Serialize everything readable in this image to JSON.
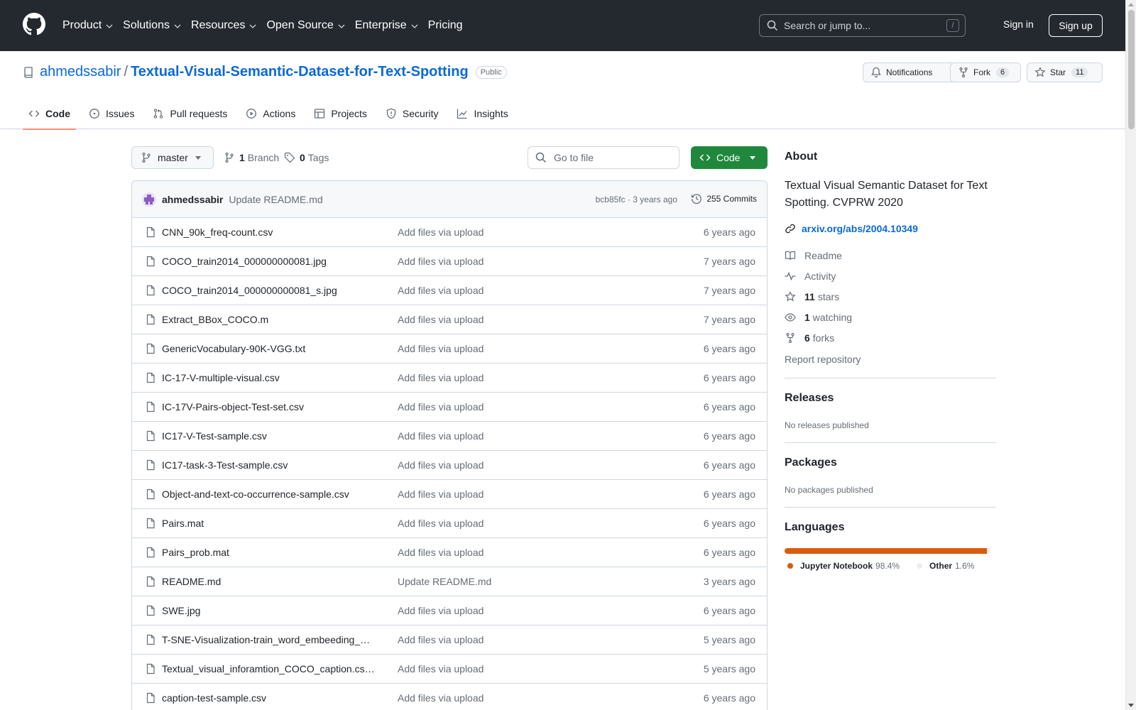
{
  "header": {
    "nav": [
      {
        "label": "Product",
        "dropdown": true
      },
      {
        "label": "Solutions",
        "dropdown": true
      },
      {
        "label": "Resources",
        "dropdown": true
      },
      {
        "label": "Open Source",
        "dropdown": true
      },
      {
        "label": "Enterprise",
        "dropdown": true
      },
      {
        "label": "Pricing",
        "dropdown": false
      }
    ],
    "search_placeholder": "Search or jump to...",
    "search_shortcut": "/",
    "signin_label": "Sign in",
    "signup_label": "Sign up"
  },
  "repo": {
    "owner": "ahmedssabir",
    "separator": "/",
    "name": "Textual-Visual-Semantic-Dataset-for-Text-Spotting",
    "visibility": "Public",
    "notifications_label": "Notifications",
    "fork_label": "Fork",
    "fork_count": "6",
    "star_label": "Star",
    "star_count": "11"
  },
  "tabs": [
    {
      "label": "Code",
      "icon": "code-icon",
      "active": true
    },
    {
      "label": "Issues",
      "icon": "issue-icon",
      "active": false
    },
    {
      "label": "Pull requests",
      "icon": "pull-request-icon",
      "active": false
    },
    {
      "label": "Actions",
      "icon": "play-icon",
      "active": false
    },
    {
      "label": "Projects",
      "icon": "table-icon",
      "active": false
    },
    {
      "label": "Security",
      "icon": "shield-icon",
      "active": false
    },
    {
      "label": "Insights",
      "icon": "graph-icon",
      "active": false
    }
  ],
  "toolbar": {
    "branch": "master",
    "branch_count": "1",
    "branch_label": "Branch",
    "tag_count": "0",
    "tag_label": "Tags",
    "goto_placeholder": "Go to file",
    "code_label": "Code"
  },
  "commit": {
    "author": "ahmedssabir",
    "message": "Update README.md",
    "sha_time": "bcb85fc · 3 years ago",
    "commits_label": "255 Commits"
  },
  "files": [
    {
      "name": "CNN_90k_freq-count.csv",
      "message": "Add files via upload",
      "age": "6 years ago"
    },
    {
      "name": "COCO_train2014_000000000081.jpg",
      "message": "Add files via upload",
      "age": "7 years ago"
    },
    {
      "name": "COCO_train2014_000000000081_s.jpg",
      "message": "Add files via upload",
      "age": "7 years ago"
    },
    {
      "name": "Extract_BBox_COCO.m",
      "message": "Add files via upload",
      "age": "7 years ago"
    },
    {
      "name": "GenericVocabulary-90K-VGG.txt",
      "message": "Add files via upload",
      "age": "6 years ago"
    },
    {
      "name": "IC-17-V-multiple-visual.csv",
      "message": "Add files via upload",
      "age": "6 years ago"
    },
    {
      "name": "IC-17V-Pairs-object-Test-set.csv",
      "message": "Add files via upload",
      "age": "6 years ago"
    },
    {
      "name": "IC17-V-Test-sample.csv",
      "message": "Add files via upload",
      "age": "6 years ago"
    },
    {
      "name": "IC17-task-3-Test-sample.csv",
      "message": "Add files via upload",
      "age": "6 years ago"
    },
    {
      "name": "Object-and-text-co-occurrence-sample.csv",
      "message": "Add files via upload",
      "age": "6 years ago"
    },
    {
      "name": "Pairs.mat",
      "message": "Add files via upload",
      "age": "6 years ago"
    },
    {
      "name": "Pairs_prob.mat",
      "message": "Add files via upload",
      "age": "6 years ago"
    },
    {
      "name": "README.md",
      "message": "Update README.md",
      "age": "3 years ago"
    },
    {
      "name": "SWE.jpg",
      "message": "Add files via upload",
      "age": "6 years ago"
    },
    {
      "name": "T-SNE-Visualization-train_word_embeeding_…",
      "message": "Add files via upload",
      "age": "5 years ago"
    },
    {
      "name": "Textual_visual_inforamtion_COCO_caption.cs…",
      "message": "Add files via upload",
      "age": "5 years ago"
    },
    {
      "name": "caption-test-sample.csv",
      "message": "Add files via upload",
      "age": "6 years ago"
    }
  ],
  "sidebar": {
    "about_title": "About",
    "description": "Textual Visual Semantic Dataset for Text Spotting. CVPRW 2020",
    "link": "arxiv.org/abs/2004.10349",
    "readme": "Readme",
    "activity": "Activity",
    "stars_count": "11",
    "stars_label": "stars",
    "watching_count": "1",
    "watching_label": "watching",
    "forks_count": "6",
    "forks_label": "forks",
    "report": "Report repository",
    "releases_title": "Releases",
    "releases_empty": "No releases published",
    "packages_title": "Packages",
    "packages_empty": "No packages published",
    "languages_title": "Languages",
    "languages": [
      {
        "name": "Jupyter Notebook",
        "percent": "98.4%",
        "value": 98.4,
        "color": "#DA5B0B"
      },
      {
        "name": "Other",
        "percent": "1.6%",
        "value": 1.6,
        "color": "#EDEDED"
      }
    ]
  }
}
